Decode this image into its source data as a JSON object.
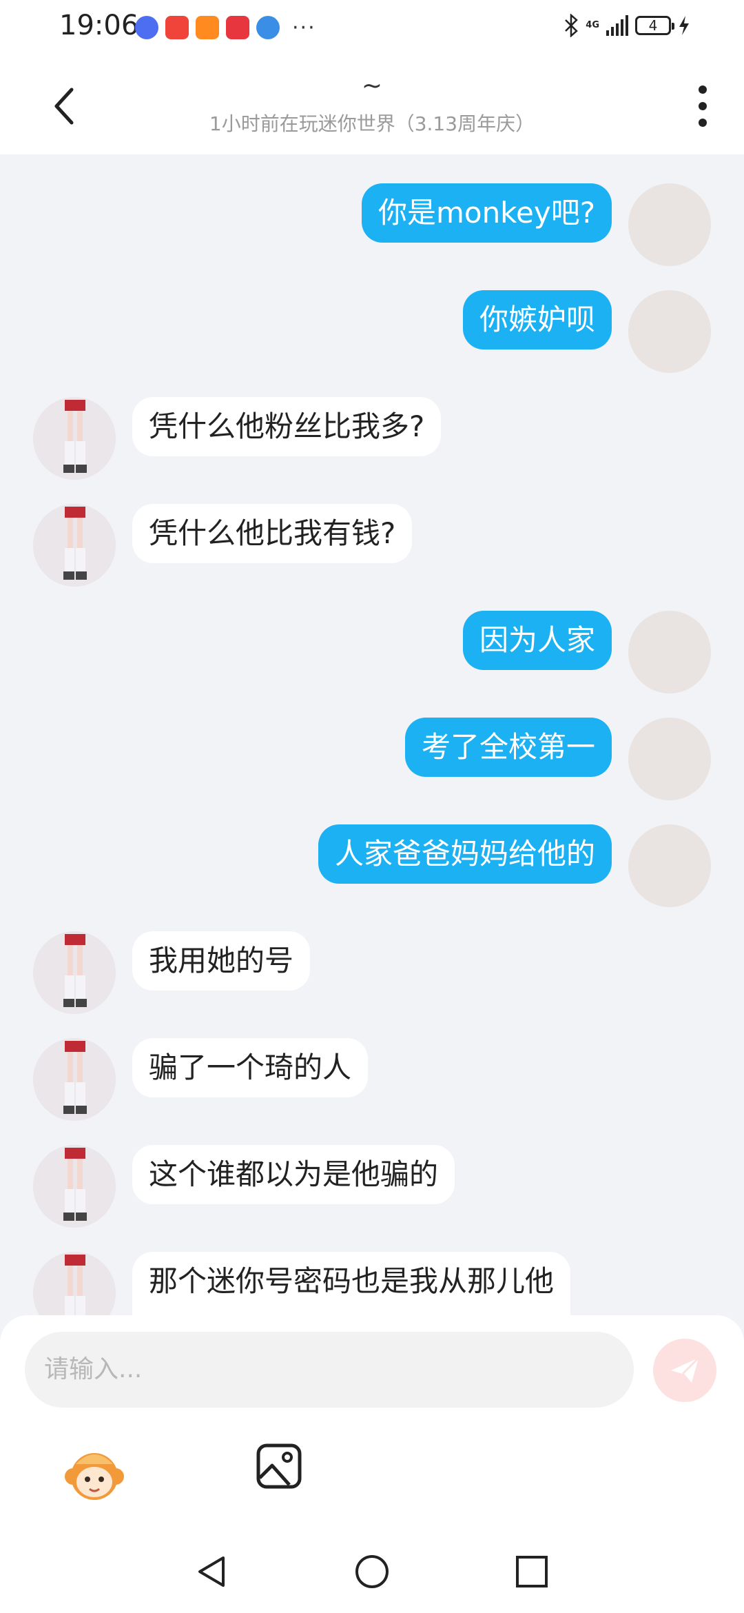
{
  "status_bar": {
    "time": "19:06",
    "network": "4G",
    "battery_level": "4",
    "overflow": "···",
    "notification_icons": [
      "music-icon",
      "doll-app-icon",
      "video-play-icon",
      "huawei-icon",
      "browser-icon"
    ]
  },
  "header": {
    "title": "~",
    "subtitle": "1小时前在玩迷你世界（3.13周年庆）"
  },
  "messages": [
    {
      "side": "mine",
      "text": "你是monkey吧?"
    },
    {
      "side": "mine",
      "text": "你嫉妒呗"
    },
    {
      "side": "theirs",
      "text": "凭什么他粉丝比我多?"
    },
    {
      "side": "theirs",
      "text": "凭什么他比我有钱?"
    },
    {
      "side": "mine",
      "text": "因为人家"
    },
    {
      "side": "mine",
      "text": "考了全校第一"
    },
    {
      "side": "mine",
      "text": "人家爸爸妈妈给他的"
    },
    {
      "side": "theirs",
      "text": "我用她的号"
    },
    {
      "side": "theirs",
      "text": "骗了一个琦的人"
    },
    {
      "side": "theirs",
      "text": "这个谁都以为是他骗的"
    },
    {
      "side": "theirs",
      "text": "那个迷你号密码也是我从那儿他"
    }
  ],
  "composer": {
    "placeholder": "请输入..."
  },
  "colors": {
    "bubble_mine": "#1cb1f3",
    "bubble_theirs": "#ffffff",
    "chat_background": "#f1f3f7",
    "send_button": "#fde1e1"
  }
}
